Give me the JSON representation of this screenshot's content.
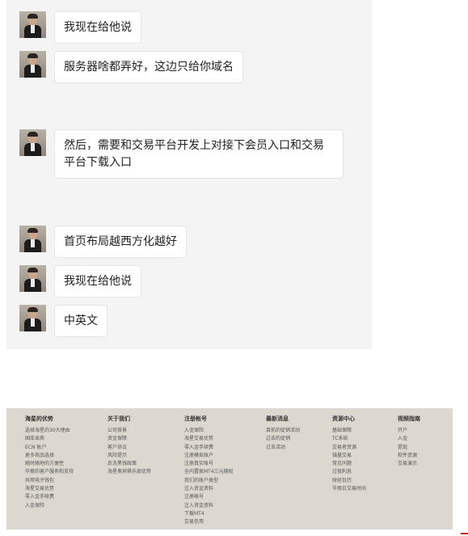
{
  "chat": {
    "messages": [
      {
        "text": "我现在给他说"
      },
      {
        "text": "服务器啥都弄好，这边只给你域名"
      },
      {
        "text": "然后，需要和交易平台开发上对接下会员入口和交易平台下载入口"
      },
      {
        "text": "首页布局越西方化越好"
      },
      {
        "text": "我现在给他说"
      },
      {
        "text": "中英文"
      }
    ]
  },
  "footer": {
    "columns": [
      {
        "title": "海星的优势",
        "items": [
          "选择海星的30大理由",
          "国库卓质",
          "ECN 账户",
          "更多商品选择",
          "随时随地的方便性",
          "华裔的客户服务和支持",
          "共用电子钱包",
          "海星交易优势",
          "零入金手续费",
          "入金保险"
        ]
      },
      {
        "title": "关于我们",
        "items": [
          "公司背景",
          "资金保障",
          "客户协议",
          "风险提示",
          "反洗黑钱政策",
          "海星奥宾俱乐部优势"
        ]
      },
      {
        "title": "注册帐号",
        "items": [
          "入金保险",
          "海星交易优势",
          "零入金手续费",
          "注册模拟账户",
          "注册真实账号",
          "全内置家MT4三元期权",
          "我们的账户类型",
          "注入资金资料",
          "注册帐号",
          "注入资金资料",
          "下载MT4",
          "交易信用"
        ]
      },
      {
        "title": "最新消息",
        "items": [
          "目前的促销活动",
          "过去的促销",
          "过去活动"
        ]
      },
      {
        "title": "资源中心",
        "items": [
          "基础保障",
          "TC系统",
          "交易者资源",
          "锚量交易",
          "常见问题",
          "过夜利息",
          "财经日历",
          "节假日交易时间"
        ]
      },
      {
        "title": "视频指南",
        "items": [
          "开户",
          "入金",
          "提现",
          "软件资源",
          "交易演示"
        ]
      }
    ]
  }
}
